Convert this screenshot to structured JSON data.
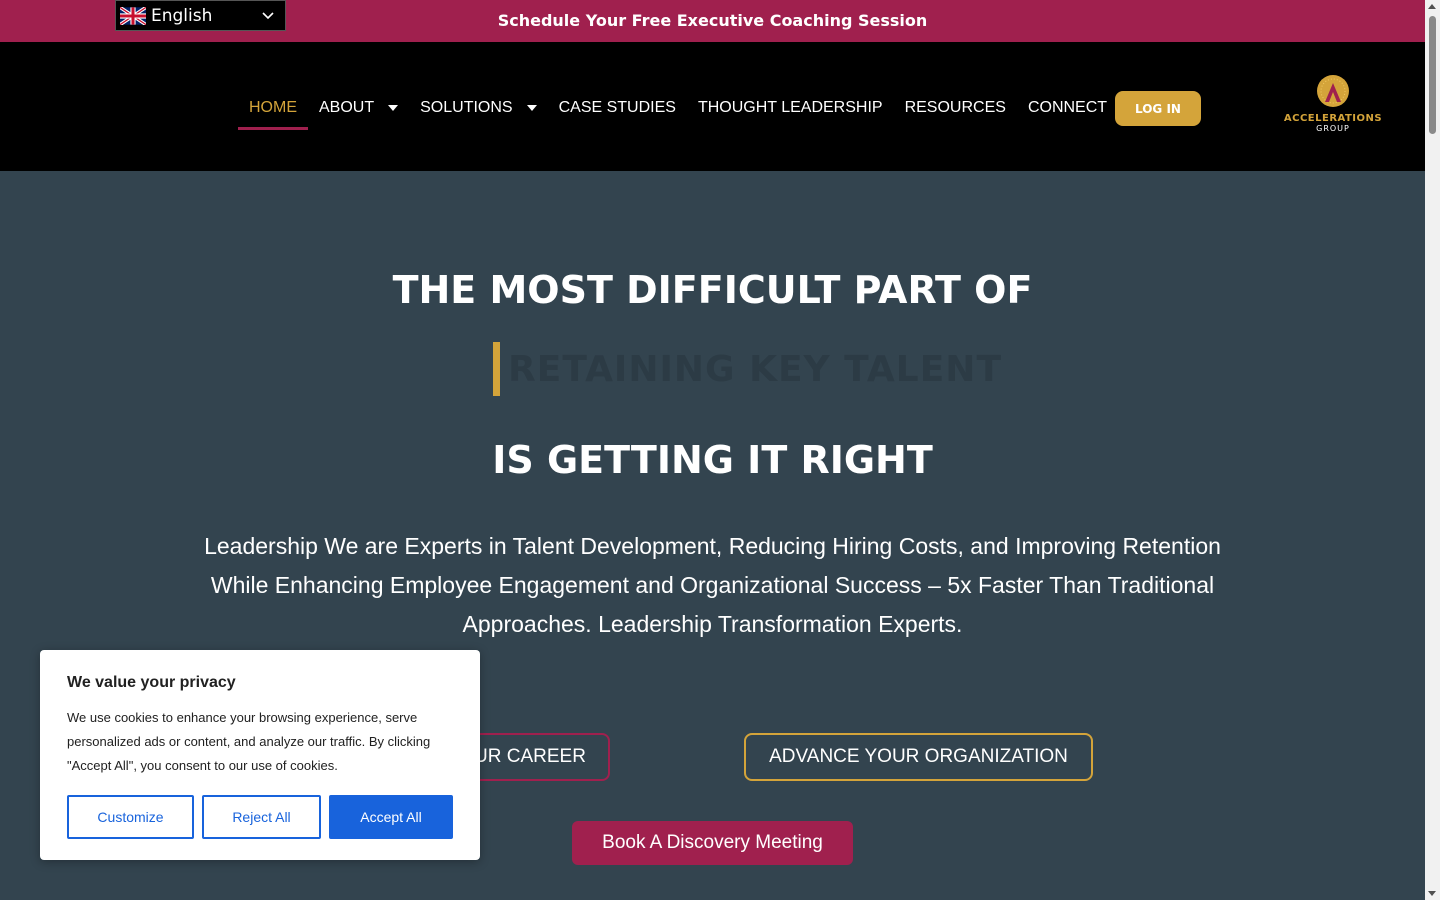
{
  "topbar": {
    "language": "English",
    "announcement": "Schedule Your Free Executive Coaching Session"
  },
  "nav": {
    "items": [
      {
        "label": "HOME",
        "active": true,
        "dropdown": false
      },
      {
        "label": "ABOUT",
        "active": false,
        "dropdown": true
      },
      {
        "label": "SOLUTIONS",
        "active": false,
        "dropdown": true
      },
      {
        "label": "CASE STUDIES",
        "active": false,
        "dropdown": false
      },
      {
        "label": "THOUGHT LEADERSHIP",
        "active": false,
        "dropdown": false
      },
      {
        "label": "RESOURCES",
        "active": false,
        "dropdown": false
      },
      {
        "label": "CONNECT",
        "active": false,
        "dropdown": false
      }
    ],
    "login_label": "LOG IN",
    "logo_text": "ACCELERATIONS",
    "logo_sub": "GROUP"
  },
  "hero": {
    "line1": "THE MOST DIFFICULT PART OF",
    "rotating_text": "RETAINING KEY TALENT",
    "line3": "IS GETTING IT RIGHT",
    "description": "Leadership We are Experts in Talent Development, Reducing Hiring Costs, and Improving Retention While Enhancing Employee Engagement and Organizational Success – 5x Faster Than Traditional Approaches. Leadership Transformation Experts.",
    "career_button": "UR CAREER",
    "org_button": "ADVANCE YOUR ORGANIZATION",
    "book_button": "Book A Discovery Meeting"
  },
  "cookie": {
    "title": "We value your privacy",
    "body": "We use cookies to enhance your browsing experience, serve personalized ads or content, and analyze our traffic. By clicking \"Accept All\", you consent to our use of cookies.",
    "customize": "Customize",
    "reject": "Reject All",
    "accept": "Accept All"
  },
  "colors": {
    "brand_crimson": "#a0204e",
    "brand_gold": "#d4a43a",
    "hero_bg": "#33444f",
    "cookie_blue": "#1863dc"
  }
}
